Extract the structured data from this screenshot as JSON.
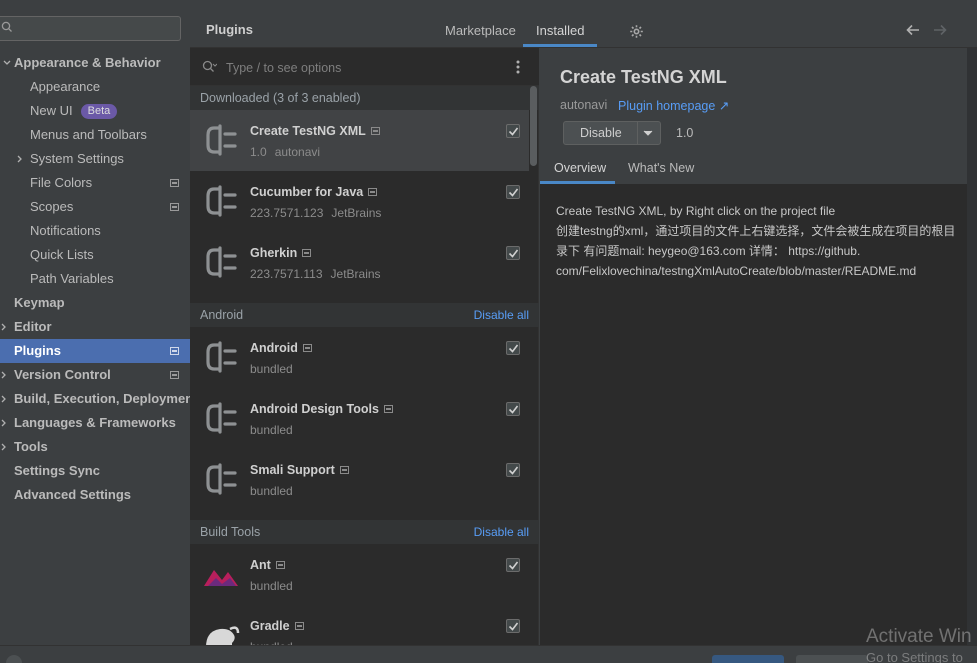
{
  "sidebar": {
    "search_placeholder": "",
    "items": [
      {
        "label": "Appearance & Behavior",
        "bold": true,
        "expanded": true
      },
      {
        "label": "Appearance"
      },
      {
        "label": "New UI",
        "badge": "Beta"
      },
      {
        "label": "Menus and Toolbars"
      },
      {
        "label": "System Settings"
      },
      {
        "label": "File Colors"
      },
      {
        "label": "Scopes"
      },
      {
        "label": "Notifications"
      },
      {
        "label": "Quick Lists"
      },
      {
        "label": "Path Variables"
      },
      {
        "label": "Keymap"
      },
      {
        "label": "Editor"
      },
      {
        "label": "Plugins",
        "selected": true
      },
      {
        "label": "Version Control"
      },
      {
        "label": "Build, Execution, Deployment"
      },
      {
        "label": "Languages & Frameworks"
      },
      {
        "label": "Tools"
      },
      {
        "label": "Settings Sync"
      },
      {
        "label": "Advanced Settings"
      }
    ]
  },
  "header": {
    "title": "Plugins",
    "tabs": [
      "Marketplace",
      "Installed"
    ],
    "active_tab": "Installed",
    "icons": [
      "gear-icon",
      "back-arrow-icon",
      "forward-arrow-icon"
    ]
  },
  "plugin_list": {
    "search_placeholder": "Type / to see options",
    "groups": [
      {
        "title": "Downloaded (3 of 3 enabled)",
        "action": "",
        "plugins": [
          {
            "name": "Create TestNG XML",
            "version": "1.0",
            "vendor": "autonavi",
            "enabled": true,
            "selected": true
          },
          {
            "name": "Cucumber for Java",
            "version": "223.7571.123",
            "vendor": "JetBrains",
            "enabled": true
          },
          {
            "name": "Gherkin",
            "version": "223.7571.113",
            "vendor": "JetBrains",
            "enabled": true
          }
        ]
      },
      {
        "title": "Android",
        "action": "Disable all",
        "plugins": [
          {
            "name": "Android",
            "version": "bundled",
            "vendor": "",
            "enabled": true
          },
          {
            "name": "Android Design Tools",
            "version": "bundled",
            "vendor": "",
            "enabled": true
          },
          {
            "name": "Smali Support",
            "version": "bundled",
            "vendor": "",
            "enabled": true
          }
        ]
      },
      {
        "title": "Build Tools",
        "action": "Disable all",
        "plugins": [
          {
            "name": "Ant",
            "version": "bundled",
            "vendor": "",
            "enabled": true,
            "icon": "ant-icon"
          },
          {
            "name": "Gradle",
            "version": "bundled",
            "vendor": "",
            "enabled": true,
            "icon": "elephant-icon"
          }
        ]
      }
    ]
  },
  "detail": {
    "title": "Create TestNG XML",
    "vendor": "autonavi",
    "homepage_link": "Plugin homepage ↗",
    "disable_button": "Disable",
    "version": "1.0",
    "tabs": [
      "Overview",
      "What's New"
    ],
    "active_tab": "Overview",
    "description_lines": [
      "Create TestNG XML, by Right click on the project file",
      "创建testng的xml，通过项目的文件上右键选择，文件会被生成在项目的根目",
      "录下 有问题mail: heygeo@163.com 详情： https://github.",
      "com/Felixlovechina/testngXmlAutoCreate/blob/master/README.md"
    ]
  },
  "watermark": {
    "line1": "Activate Win",
    "line2": "Go to Settings to"
  },
  "colors": {
    "accent": "#4b6eaf",
    "link": "#589df6",
    "background": "#3c3f41",
    "panel": "#2b2b2b"
  }
}
